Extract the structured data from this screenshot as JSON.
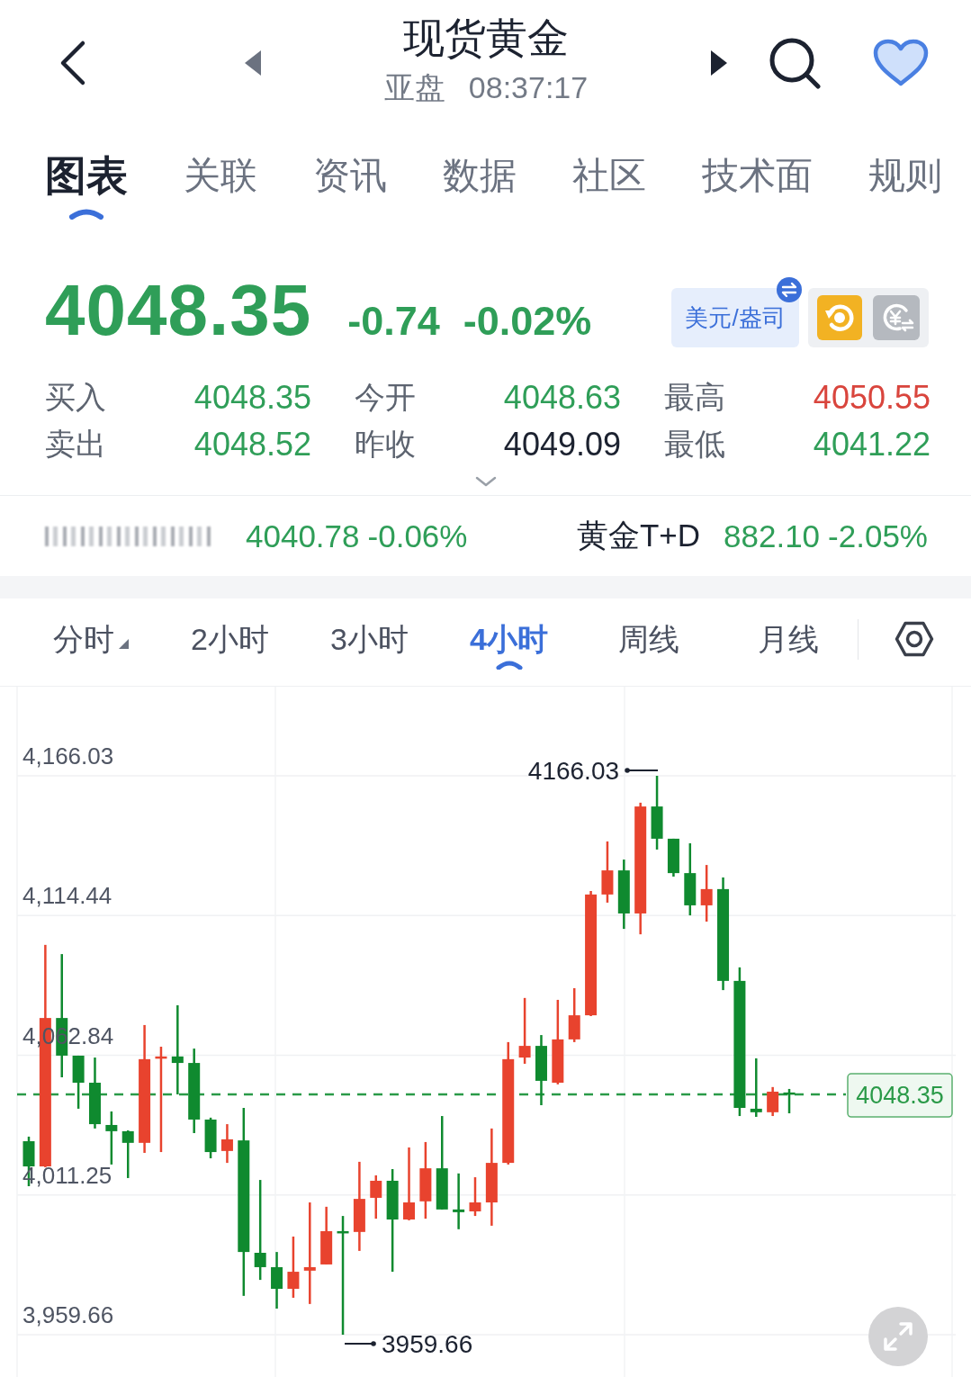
{
  "header": {
    "title": "现货黄金",
    "session": "亚盘",
    "time": "08:37:17"
  },
  "tabs": [
    {
      "label": "图表",
      "selected": true
    },
    {
      "label": "关联",
      "selected": false
    },
    {
      "label": "资讯",
      "selected": false
    },
    {
      "label": "数据",
      "selected": false
    },
    {
      "label": "社区",
      "selected": false
    },
    {
      "label": "技术面",
      "selected": false
    },
    {
      "label": "规则",
      "selected": false
    }
  ],
  "quote": {
    "price": "4048.35",
    "change": "-0.74",
    "change_percent": "-0.02%",
    "color": "#2f9e58",
    "unit": "美元/盎司"
  },
  "stats": [
    {
      "label": "买入",
      "value": "4048.35",
      "color": "#2f9e58"
    },
    {
      "label": "今开",
      "value": "4048.63",
      "color": "#2f9e58"
    },
    {
      "label": "最高",
      "value": "4050.55",
      "color": "#d9453d"
    },
    {
      "label": "卖出",
      "value": "4048.52",
      "color": "#2f9e58"
    },
    {
      "label": "昨收",
      "value": "4049.09",
      "color": "#1c2230"
    },
    {
      "label": "最低",
      "value": "4041.22",
      "color": "#2f9e58"
    }
  ],
  "related": [
    {
      "kind": "blurred",
      "price": "4040.78",
      "change": "-0.06%",
      "color": "#2f9e58"
    },
    {
      "kind": "named",
      "name": "黄金T+D",
      "price": "882.10",
      "change": "-2.05%",
      "color": "#2f9e58"
    }
  ],
  "periods": [
    {
      "label": "分时",
      "selected": false,
      "dropdown": true
    },
    {
      "label": "2小时",
      "selected": false,
      "dropdown": false
    },
    {
      "label": "3小时",
      "selected": false,
      "dropdown": false
    },
    {
      "label": "4小时",
      "selected": true,
      "dropdown": false
    },
    {
      "label": "周线",
      "selected": false,
      "dropdown": false
    },
    {
      "label": "月线",
      "selected": false,
      "dropdown": false
    }
  ],
  "chart": {
    "high_label": "4166.03",
    "low_label": "3959.66",
    "chart_data": {
      "type": "candlestick",
      "grid": true,
      "ohlc": [
        [
          4031.1,
          4032.8,
          4014.5,
          4021.8
        ],
        [
          4021.8,
          4103.6,
          4021.5,
          4076.6
        ],
        [
          4076.6,
          4100.2,
          4054.7,
          4062.7
        ],
        [
          4062.7,
          4062.7,
          4043.1,
          4052.7
        ],
        [
          4052.7,
          4062.0,
          4035.8,
          4037.4
        ],
        [
          4037.1,
          4042.1,
          4022.5,
          4034.8
        ],
        [
          4034.8,
          4035.1,
          4017.5,
          4030.5
        ],
        [
          4030.5,
          4074.0,
          4026.8,
          4061.4
        ],
        [
          4061.7,
          4066.0,
          4027.1,
          4062.4
        ],
        [
          4062.4,
          4081.3,
          4048.4,
          4060.0
        ],
        [
          4060.0,
          4065.3,
          4034.1,
          4039.1
        ],
        [
          4039.1,
          4039.8,
          4024.8,
          4027.1
        ],
        [
          4027.5,
          4037.4,
          4023.1,
          4031.8
        ],
        [
          4031.4,
          4043.4,
          3974.0,
          3990.2
        ],
        [
          3989.9,
          4016.8,
          3979.9,
          3984.6
        ],
        [
          3984.6,
          3990.2,
          3969.3,
          3976.6
        ],
        [
          3976.6,
          3995.9,
          3973.3,
          3982.9
        ],
        [
          3983.3,
          4008.5,
          3971.0,
          3984.6
        ],
        [
          3985.6,
          4006.9,
          3985.6,
          3997.9
        ],
        [
          3997.9,
          4003.5,
          3959.66,
          3997.2
        ],
        [
          3997.6,
          4023.5,
          3990.6,
          4009.8
        ],
        [
          4010.2,
          4018.5,
          4002.5,
          4016.5
        ],
        [
          4016.5,
          4020.8,
          3982.9,
          4002.2
        ],
        [
          4002.2,
          4028.8,
          4001.9,
          4008.5
        ],
        [
          4008.9,
          4030.8,
          4002.5,
          4021.1
        ],
        [
          4021.1,
          4040.4,
          4005.9,
          4005.9
        ],
        [
          4005.9,
          4019.2,
          3998.6,
          4004.9
        ],
        [
          4005.2,
          4017.8,
          4003.5,
          4008.5
        ],
        [
          4008.5,
          4035.8,
          3999.9,
          4023.1
        ],
        [
          4023.1,
          4067.7,
          4022.5,
          4061.4
        ],
        [
          4062.0,
          4084.0,
          4059.7,
          4066.3
        ],
        [
          4066.3,
          4070.3,
          4044.4,
          4053.4
        ],
        [
          4052.7,
          4083.3,
          4052.1,
          4068.7
        ],
        [
          4068.7,
          4087.6,
          4067.7,
          4077.6
        ],
        [
          4077.6,
          4123.5,
          4077.3,
          4122.2
        ],
        [
          4122.2,
          4141.8,
          4119.2,
          4131.1
        ],
        [
          4131.1,
          4135.1,
          4109.5,
          4115.2
        ],
        [
          4115.2,
          4156.1,
          4107.5,
          4154.7
        ],
        [
          4154.7,
          4166.03,
          4138.8,
          4142.8
        ],
        [
          4142.8,
          4142.8,
          4128.8,
          4130.1
        ],
        [
          4130.1,
          4141.1,
          4114.5,
          4118.2
        ],
        [
          4118.2,
          4133.1,
          4112.2,
          4124.2
        ],
        [
          4124.2,
          4128.5,
          4086.9,
          4090.3
        ],
        [
          4090.3,
          4095.3,
          4040.4,
          4043.4
        ],
        [
          4043.1,
          4061.7,
          4040.1,
          4041.8
        ],
        [
          4041.8,
          4051.1,
          4040.4,
          4049.4
        ],
        [
          4049.1,
          4050.4,
          4041.4,
          4048.35
        ]
      ],
      "ylim": [
        3959.66,
        4166.03
      ],
      "yticks": [
        {
          "value": 4166.03,
          "label": "4,166.03"
        },
        {
          "value": 4114.44,
          "label": "4,114.44"
        },
        {
          "value": 4062.84,
          "label": "4,062.84"
        },
        {
          "value": 4011.25,
          "label": "4,011.25"
        },
        {
          "value": 3959.66,
          "label": "3,959.66"
        }
      ],
      "ref_lines": [
        {
          "axis": "y",
          "value": 4048.35,
          "label": "4048.35",
          "color": "#2a9a48"
        }
      ]
    }
  }
}
